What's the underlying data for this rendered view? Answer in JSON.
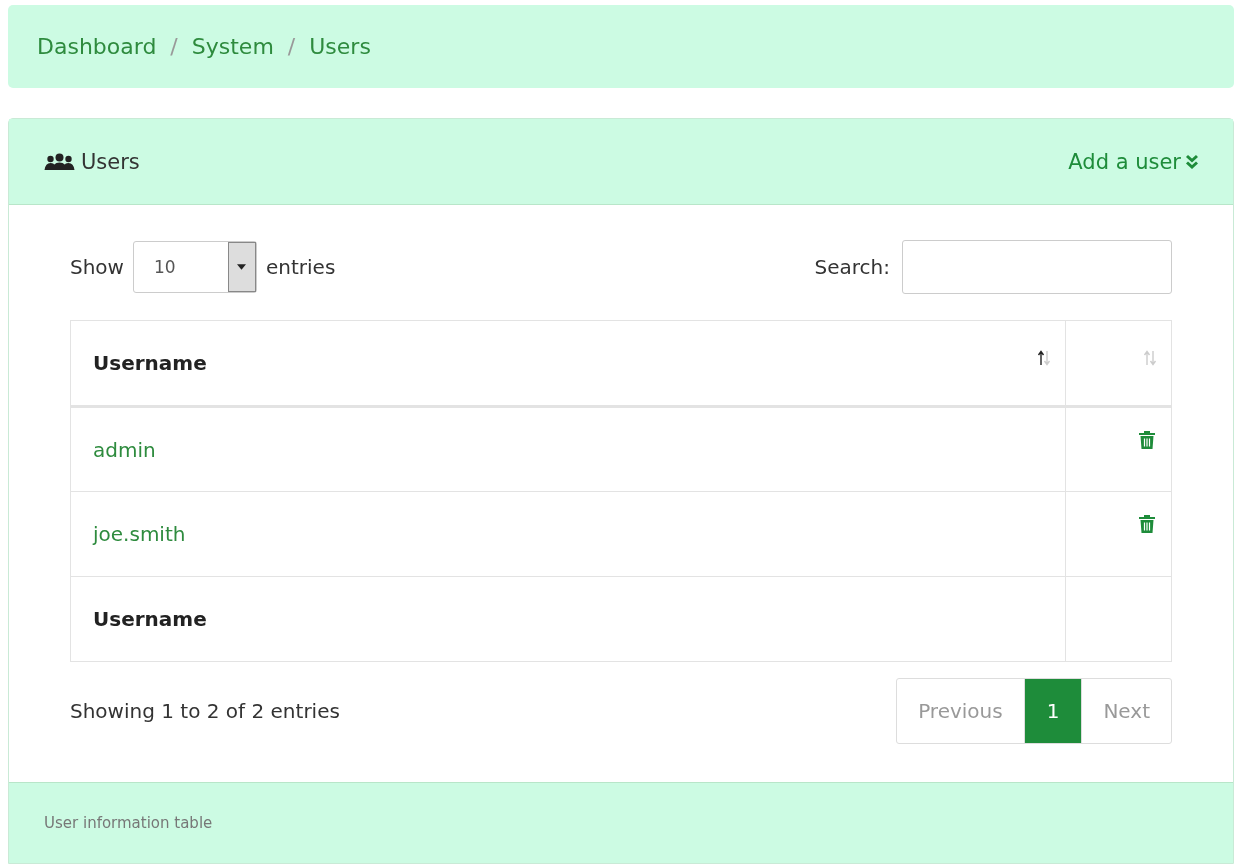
{
  "breadcrumb": [
    {
      "kind": "link",
      "text": "Dashboard"
    },
    {
      "kind": "separator",
      "text": "/"
    },
    {
      "kind": "link",
      "text": "System"
    },
    {
      "kind": "separator",
      "text": "/"
    },
    {
      "kind": "link",
      "text": "Users"
    }
  ],
  "panel": {
    "title": "Users",
    "action": "Add a user",
    "footer": "User information table"
  },
  "length_control": {
    "label_before": "Show",
    "value": "10",
    "label_after": "entries"
  },
  "search": {
    "label": "Search:"
  },
  "table": {
    "columns": [
      {
        "label": "Username",
        "sorted": true
      },
      {
        "sorted": false
      }
    ],
    "rows": [
      {
        "username": "admin"
      },
      {
        "username": "joe.smith"
      }
    ],
    "footer": [
      "Username"
    ]
  },
  "info": "Showing 1 to 2 of 2 entries",
  "pagination": {
    "previous": {
      "label": "Previous",
      "disabled": true
    },
    "pages": [
      {
        "label": "1",
        "selected": true
      }
    ],
    "next": {
      "label": "Next",
      "disabled": true
    }
  }
}
